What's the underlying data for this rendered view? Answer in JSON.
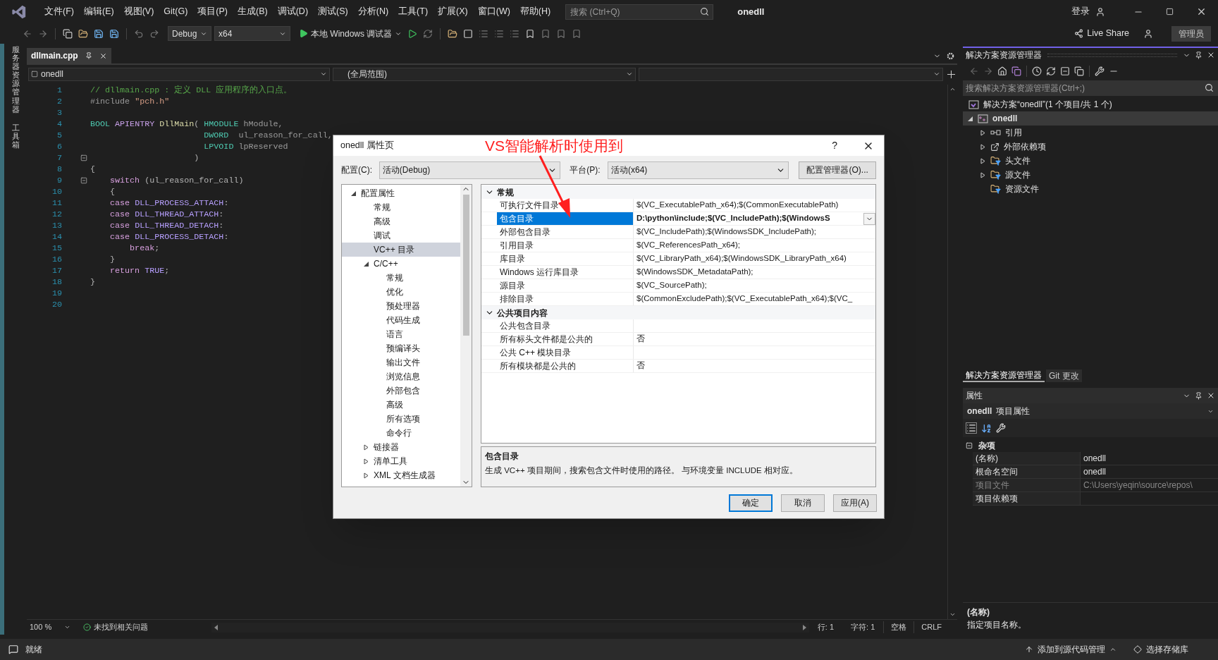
{
  "menu_bar": {
    "items": [
      "文件(F)",
      "编辑(E)",
      "视图(V)",
      "Git(G)",
      "项目(P)",
      "生成(B)",
      "调试(D)",
      "测试(S)",
      "分析(N)",
      "工具(T)",
      "扩展(X)",
      "窗口(W)",
      "帮助(H)"
    ],
    "search": {
      "placeholder": "搜索 (Ctrl+Q)"
    },
    "title": "onedll",
    "sign_in": "登录"
  },
  "toolbar": {
    "configuration": "Debug",
    "platform": "x64",
    "debugger": "本地 Windows 调试器",
    "live_share": "Live Share",
    "admin_badge": "管理员"
  },
  "side_tabs": [
    "服务器资源管理器",
    "工具箱"
  ],
  "editor": {
    "tabs": [
      {
        "label": "dllmain.cpp",
        "selected": true
      }
    ],
    "nav": [
      "onedll",
      "(全局范围)"
    ],
    "lines": [
      {
        "number": "1",
        "tokens": [
          {
            "text": "// dllmain.cpp : 定义 DLL 应用程序的入口点。",
            "kind": "comment"
          }
        ]
      },
      {
        "number": "2",
        "tokens": [
          {
            "text": "#include ",
            "kind": "preproc"
          },
          {
            "text": "\"pch.h\"",
            "kind": "string"
          }
        ]
      },
      {
        "number": "3"
      },
      {
        "number": "4",
        "tokens": [
          {
            "text": "BOOL ",
            "kind": "type"
          },
          {
            "text": "APIENTRY ",
            "kind": "macro"
          },
          {
            "text": "DllMain",
            "kind": "func"
          },
          {
            "text": "( ",
            "kind": "punct"
          },
          {
            "text": "HMODULE ",
            "kind": "type"
          },
          {
            "text": "hModule,",
            "kind": "param"
          }
        ]
      },
      {
        "number": "5",
        "tokens": [
          {
            "text": "                       DWORD  ",
            "kind": "type"
          },
          {
            "text": "ul_reason_for_call,",
            "kind": "param"
          }
        ]
      },
      {
        "number": "6",
        "tokens": [
          {
            "text": "                       LPVOID ",
            "kind": "type"
          },
          {
            "text": "lpReserved",
            "kind": "param"
          }
        ]
      },
      {
        "number": "7",
        "fold": true,
        "tokens": [
          {
            "text": "                     )",
            "kind": "punct"
          }
        ]
      },
      {
        "number": "8",
        "tokens": [
          {
            "text": "{",
            "kind": "punct"
          }
        ]
      },
      {
        "number": "9",
        "fold": true,
        "tokens": [
          {
            "text": "    switch ",
            "kind": "keyword"
          },
          {
            "text": "(ul_reason_for_call)",
            "kind": "punct"
          }
        ]
      },
      {
        "number": "10",
        "tokens": [
          {
            "text": "    {",
            "kind": "punct"
          }
        ]
      },
      {
        "number": "11",
        "tokens": [
          {
            "text": "    case ",
            "kind": "keyword"
          },
          {
            "text": "DLL_PROCESS_ATTACH",
            "kind": "constant"
          },
          {
            "text": ":",
            "kind": "punct"
          }
        ]
      },
      {
        "number": "12",
        "tokens": [
          {
            "text": "    case ",
            "kind": "keyword"
          },
          {
            "text": "DLL_THREAD_ATTACH",
            "kind": "constant"
          },
          {
            "text": ":",
            "kind": "punct"
          }
        ]
      },
      {
        "number": "13",
        "tokens": [
          {
            "text": "    case ",
            "kind": "keyword"
          },
          {
            "text": "DLL_THREAD_DETACH",
            "kind": "constant"
          },
          {
            "text": ":",
            "kind": "punct"
          }
        ]
      },
      {
        "number": "14",
        "tokens": [
          {
            "text": "    case ",
            "kind": "keyword"
          },
          {
            "text": "DLL_PROCESS_DETACH",
            "kind": "constant"
          },
          {
            "text": ":",
            "kind": "punct"
          }
        ]
      },
      {
        "number": "15",
        "tokens": [
          {
            "text": "        break",
            "kind": "keyword"
          },
          {
            "text": ";",
            "kind": "punct"
          }
        ]
      },
      {
        "number": "16",
        "tokens": [
          {
            "text": "    }",
            "kind": "punct"
          }
        ]
      },
      {
        "number": "17",
        "tokens": [
          {
            "text": "    return ",
            "kind": "keyword"
          },
          {
            "text": "TRUE",
            "kind": "constant"
          },
          {
            "text": ";",
            "kind": "punct"
          }
        ]
      },
      {
        "number": "18",
        "tokens": [
          {
            "text": "}",
            "kind": "punct"
          }
        ]
      },
      {
        "number": "19"
      },
      {
        "number": "20"
      }
    ],
    "zoom": "100 %",
    "issues": "未找到相关问题",
    "line_pos": "行: 1",
    "char_pos": "字符: 1",
    "indent": "空格",
    "eol": "CRLF"
  },
  "dialog": {
    "title": "onedll 属性页",
    "help": "?",
    "config_label": "配置(C):",
    "config_value": "活动(Debug)",
    "platform_label": "平台(P):",
    "platform_value": "活动(x64)",
    "config_manager": "配置管理器(O)...",
    "tree": [
      {
        "label": "配置属性",
        "expanded": true,
        "selected": false,
        "children": [
          {
            "label": "常规",
            "selected": false
          },
          {
            "label": "高级",
            "selected": false
          },
          {
            "label": "调试",
            "selected": false
          },
          {
            "label": "VC++ 目录",
            "selected": true
          },
          {
            "label": "C/C++",
            "expanded": true,
            "selected": false,
            "children": [
              {
                "label": "常规",
                "selected": false
              },
              {
                "label": "优化",
                "selected": false
              },
              {
                "label": "预处理器",
                "selected": false
              },
              {
                "label": "代码生成",
                "selected": false
              },
              {
                "label": "语言",
                "selected": false
              },
              {
                "label": "预编译头",
                "selected": false
              },
              {
                "label": "输出文件",
                "selected": false
              },
              {
                "label": "浏览信息",
                "selected": false
              },
              {
                "label": "外部包含",
                "selected": false
              },
              {
                "label": "高级",
                "selected": false
              },
              {
                "label": "所有选项",
                "selected": false
              },
              {
                "label": "命令行",
                "selected": false
              }
            ]
          },
          {
            "label": "链接器",
            "expanded": false,
            "selected": false
          },
          {
            "label": "清单工具",
            "expanded": false,
            "selected": false
          },
          {
            "label": "XML 文档生成器",
            "expanded": false,
            "selected": false
          }
        ]
      }
    ],
    "grid": [
      {
        "label": "常规",
        "expanded": true,
        "rows": [
          {
            "name": "可执行文件目录",
            "value": "$(VC_ExecutablePath_x64);$(CommonExecutablePath)",
            "selected": false
          },
          {
            "name": "包含目录",
            "value": "D:\\python\\include;$(VC_IncludePath);$(WindowsS",
            "selected": true
          },
          {
            "name": "外部包含目录",
            "value": "$(VC_IncludePath);$(WindowsSDK_IncludePath);",
            "selected": false
          },
          {
            "name": "引用目录",
            "value": "$(VC_ReferencesPath_x64);",
            "selected": false
          },
          {
            "name": "库目录",
            "value": "$(VC_LibraryPath_x64);$(WindowsSDK_LibraryPath_x64)",
            "selected": false
          },
          {
            "name": "Windows 运行库目录",
            "value": "$(WindowsSDK_MetadataPath);",
            "selected": false
          },
          {
            "name": "源目录",
            "value": "$(VC_SourcePath);",
            "selected": false
          },
          {
            "name": "排除目录",
            "value": "$(CommonExcludePath);$(VC_ExecutablePath_x64);$(VC_",
            "selected": false
          }
        ]
      },
      {
        "label": "公共项目内容",
        "expanded": true,
        "rows": [
          {
            "name": "公共包含目录",
            "selected": false
          },
          {
            "name": "所有标头文件都是公共的",
            "value": "否",
            "selected": false
          },
          {
            "name": "公共 C++ 模块目录",
            "selected": false
          },
          {
            "name": "所有模块都是公共的",
            "value": "否",
            "selected": false
          }
        ]
      }
    ],
    "description": {
      "title": "包含目录",
      "text": "生成 VC++ 项目期间，搜索包含文件时使用的路径。 与环境变量 INCLUDE 相对应。"
    },
    "buttons": [
      {
        "label": "确定",
        "default": true
      },
      {
        "label": "取消",
        "default": false
      },
      {
        "label": "应用(A)",
        "default": false
      }
    ]
  },
  "annotation": {
    "text": "VS智能解析时使用到"
  },
  "solution_explorer": {
    "title": "解决方案资源管理器",
    "search": {
      "placeholder": "搜索解决方案资源管理器(Ctrl+;)"
    },
    "tree": [
      {
        "label": "解决方案“onedll”(1 个项目/共 1 个)",
        "kind": "solution",
        "selected": false,
        "children": [
          {
            "label": "onedll",
            "kind": "project",
            "expanded": true,
            "selected": true,
            "children": [
              {
                "label": "引用",
                "kind": "references",
                "expanded": false,
                "selected": false
              },
              {
                "label": "外部依赖项",
                "kind": "external",
                "expanded": false,
                "selected": false
              },
              {
                "label": "头文件",
                "kind": "filter",
                "expanded": false,
                "selected": false
              },
              {
                "label": "源文件",
                "kind": "filter",
                "expanded": false,
                "selected": false
              },
              {
                "label": "资源文件",
                "kind": "filter",
                "selected": false
              }
            ]
          }
        ]
      }
    ],
    "tabs": [
      {
        "label": "解决方案资源管理器",
        "selected": true
      },
      {
        "label": "Git 更改",
        "selected": false
      }
    ]
  },
  "properties": {
    "title": "属性",
    "object_name": "onedll",
    "object_type": "项目属性",
    "category": {
      "label": "杂项",
      "expanded": true,
      "rows": [
        {
          "name": "(名称)",
          "value": "onedll",
          "disabled": false
        },
        {
          "name": "根命名空间",
          "value": "onedll",
          "disabled": false
        },
        {
          "name": "项目文件",
          "value": "C:\\Users\\yeqin\\source\\repos\\",
          "disabled": true
        },
        {
          "name": "项目依赖项",
          "disabled": false
        }
      ]
    },
    "description": {
      "title": "(名称)",
      "text": "指定项目名称。"
    }
  },
  "status_bar": {
    "state": "就绪",
    "source_control": "添加到源代码管理",
    "repository": "选择存储库"
  }
}
